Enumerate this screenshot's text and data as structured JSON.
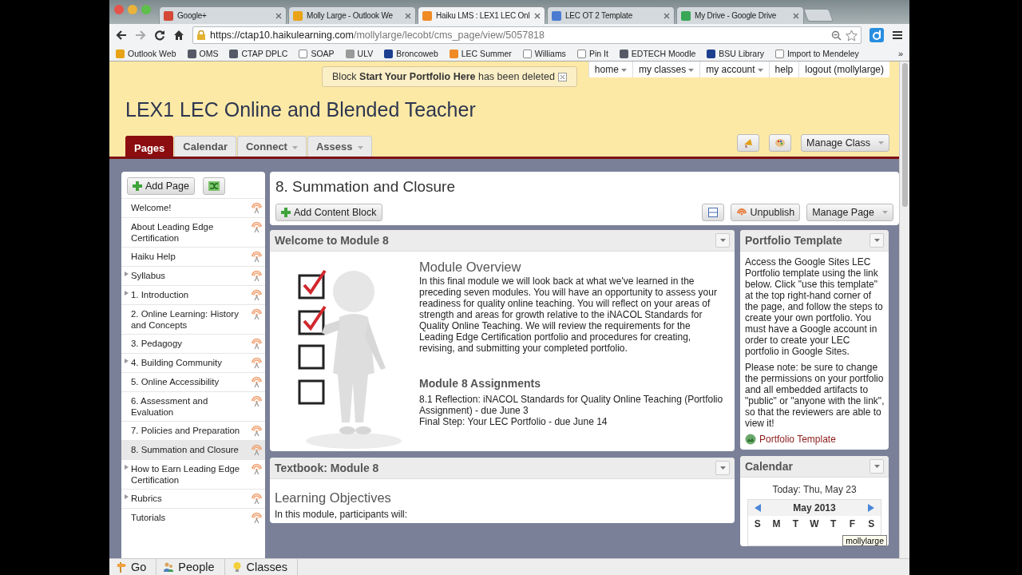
{
  "browser": {
    "tabs": [
      {
        "label": "Google+",
        "kind": "google",
        "selected": false
      },
      {
        "label": "Molly Large - Outlook We",
        "kind": "outlook",
        "selected": false
      },
      {
        "label": "Haiku LMS : LEX1 LEC Onl",
        "kind": "haiku",
        "selected": true
      },
      {
        "label": "LEC OT 2 Template",
        "kind": "doc",
        "selected": false
      },
      {
        "label": "My Drive - Google Drive",
        "kind": "drive",
        "selected": false
      }
    ],
    "url_host": "https://ctap10.haikulearning.com",
    "url_path": "/mollylarge/lecobt/cms_page/view/5057818",
    "bookmarks": [
      {
        "label": "Outlook Web",
        "kind": "outlook"
      },
      {
        "label": "OMS",
        "kind": "globe"
      },
      {
        "label": "CTAP DPLC",
        "kind": "globe"
      },
      {
        "label": "SOAP",
        "kind": "page"
      },
      {
        "label": "ULV",
        "kind": "ulv"
      },
      {
        "label": "Broncoweb",
        "kind": "b"
      },
      {
        "label": "LEC Summer",
        "kind": "haiku"
      },
      {
        "label": "Williams",
        "kind": "page"
      },
      {
        "label": "Pin It",
        "kind": "page"
      },
      {
        "label": "EDTECH Moodle",
        "kind": "globe"
      },
      {
        "label": "BSU Library",
        "kind": "b"
      },
      {
        "label": "Import to Mendeley",
        "kind": "page"
      }
    ],
    "bookmarks_more": "»"
  },
  "notice": "Block **Start Your Portfolio Here** has been deleted",
  "user_menu": [
    {
      "label": "home",
      "dropdown": true
    },
    {
      "label": "my classes",
      "dropdown": true
    },
    {
      "label": "my account",
      "dropdown": true
    },
    {
      "label": "help",
      "dropdown": false
    },
    {
      "label": "logout (mollylarge)",
      "dropdown": false
    }
  ],
  "class_title": "LEX1 LEC Online and Blended Teacher",
  "nav_tabs": [
    {
      "label": "Pages",
      "selected": true,
      "dropdown": false
    },
    {
      "label": "Calendar",
      "selected": false,
      "dropdown": false
    },
    {
      "label": "Connect",
      "selected": false,
      "dropdown": true
    },
    {
      "label": "Assess",
      "selected": false,
      "dropdown": true
    }
  ],
  "manage_class": "Manage Class",
  "sidebar": {
    "add_page": "Add Page",
    "items": [
      {
        "label": "Welcome!",
        "expandable": false,
        "selected": false
      },
      {
        "label": "About Leading Edge Certification",
        "expandable": false,
        "selected": false
      },
      {
        "label": "Haiku Help",
        "expandable": false,
        "selected": false
      },
      {
        "label": "Syllabus",
        "expandable": true,
        "selected": false
      },
      {
        "label": "1. Introduction",
        "expandable": true,
        "selected": false
      },
      {
        "label": "2. Online Learning: History and Concepts",
        "expandable": false,
        "selected": false
      },
      {
        "label": "3. Pedagogy",
        "expandable": false,
        "selected": false
      },
      {
        "label": "4. Building Community",
        "expandable": true,
        "selected": false
      },
      {
        "label": "5. Online Accessibility",
        "expandable": false,
        "selected": false
      },
      {
        "label": "6. Assessment and Evaluation",
        "expandable": false,
        "selected": false
      },
      {
        "label": "7. Policies and Preparation",
        "expandable": false,
        "selected": false
      },
      {
        "label": "8. Summation and Closure",
        "expandable": false,
        "selected": true
      },
      {
        "label": "How to Earn Leading Edge Certification",
        "expandable": true,
        "selected": false
      },
      {
        "label": "Rubrics",
        "expandable": true,
        "selected": false
      },
      {
        "label": "Tutorials",
        "expandable": false,
        "selected": false
      }
    ]
  },
  "page": {
    "title": "8. Summation and Closure",
    "add_content_block": "Add Content Block",
    "unpublish": "Unpublish",
    "manage_page": "Manage Page"
  },
  "welcome_block": {
    "title": "Welcome to Module 8",
    "overview_heading": "Module Overview",
    "overview": "In this final module we will look back at what we've learned in the preceding seven modules. You will have an opportunity to assess your readiness for quality online teaching. You will reflect on your areas of strength and areas for growth relative to the iNACOL Standards for Quality Online Teaching. We will review the requirements for the Leading Edge Certification portfolio and procedures for creating, revising, and submitting your completed portfolio.",
    "assignments_heading": "Module 8 Assignments",
    "assignments": [
      "8.1 Reflection: iNACOL Standards for Quality Online Teaching (Portfolio Assignment) - due June 3",
      "Final Step: Your LEC Portfolio  - due June 14"
    ]
  },
  "textbook_block": {
    "title": "Textbook: Module 8",
    "heading": "Learning Objectives",
    "intro": "In this module, participants will:"
  },
  "portfolio_block": {
    "title": "Portfolio Template",
    "paragraphs": [
      "Access the Google Sites LEC Portfolio template using the link below. Click \"use this template\" at the top right-hand corner of the page, and follow the steps to create your own portfolio. You must have a Google account in order to create your LEC portfolio in Google Sites.",
      "Please note: be sure to change the permissions on your portfolio and all embedded artifacts to \"public\" or \"anyone with the link\", so that the reviewers are able to view it!"
    ],
    "link": "Portfolio Template"
  },
  "calendar_block": {
    "title": "Calendar",
    "today": "Today: Thu, May 23",
    "month": "May 2013",
    "weekdays": [
      "S",
      "M",
      "T",
      "W",
      "T",
      "F",
      "S"
    ]
  },
  "tooltip": "mollylarge",
  "taskbar": [
    {
      "label": "Go",
      "kind": "go"
    },
    {
      "label": "People",
      "kind": "people"
    },
    {
      "label": "Classes",
      "kind": "classes"
    }
  ]
}
